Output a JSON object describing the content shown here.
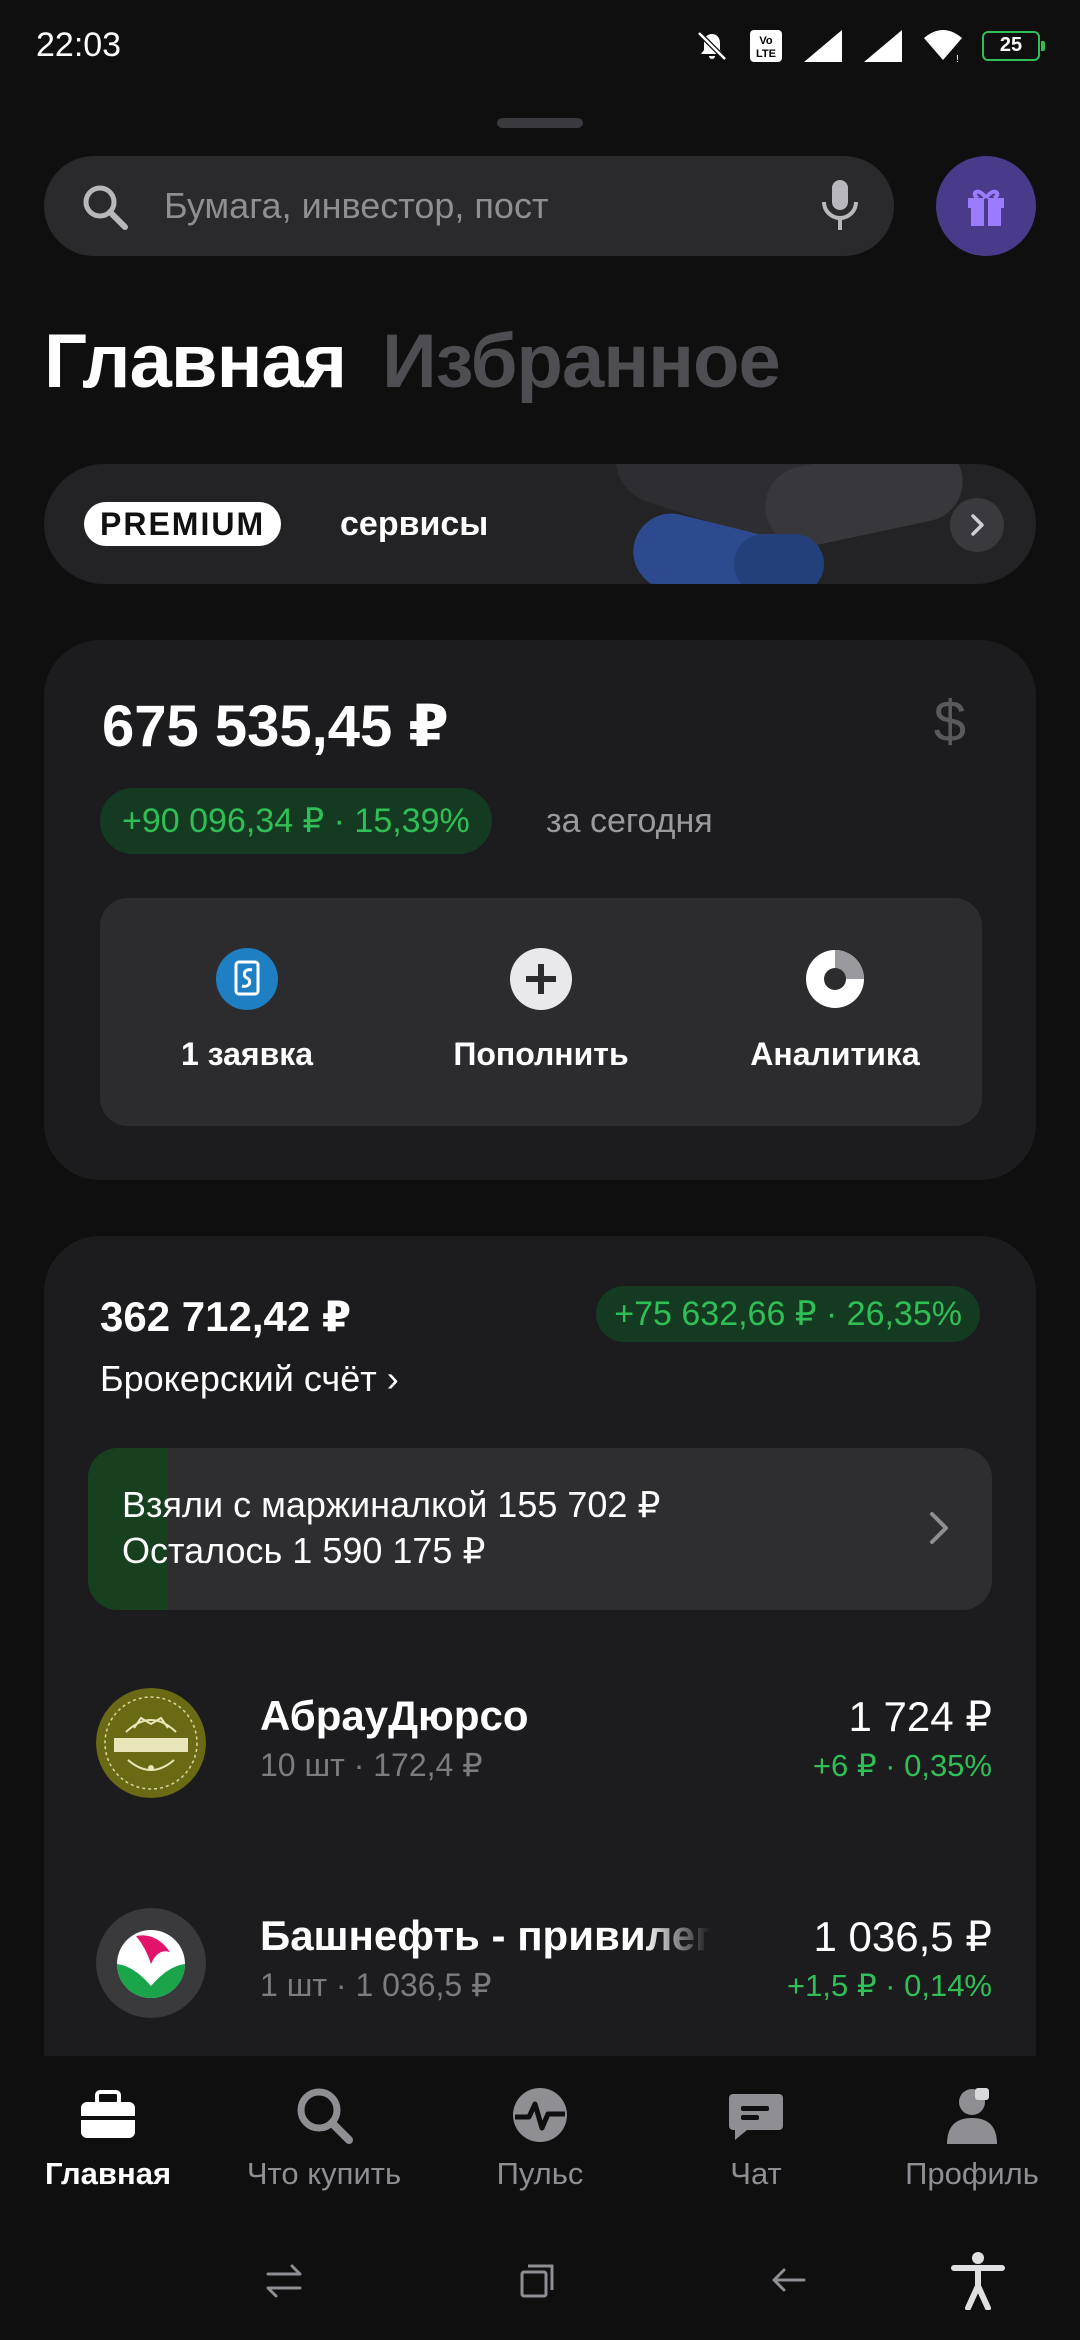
{
  "status_bar": {
    "time": "22:03",
    "battery": "25",
    "icons": [
      "mute-icon",
      "volte-icon",
      "signal-icon",
      "signal-icon",
      "wifi-icon",
      "battery-icon"
    ]
  },
  "search": {
    "placeholder": "Бумага, инвестор, пост"
  },
  "tabs": [
    {
      "label": "Главная",
      "active": true
    },
    {
      "label": "Избранное",
      "active": false
    }
  ],
  "premium": {
    "badge": "PREMIUM",
    "label": "сервисы"
  },
  "portfolio": {
    "total": "675 535,45 ₽",
    "currency_icon": "$",
    "gain": "+90 096,34 ₽ · 15,39%",
    "gain_period": "за сегодня",
    "actions": [
      {
        "label": "1 заявка",
        "icon": "order-icon"
      },
      {
        "label": "Пополнить",
        "icon": "plus-icon"
      },
      {
        "label": "Аналитика",
        "icon": "analytics-icon"
      }
    ]
  },
  "broker": {
    "amount": "362 712,42 ₽",
    "gain": "+75 632,66 ₽ · 26,35%",
    "account_link": "Брокерский счёт ›",
    "margin": {
      "line1": "Взяли с маржиналкой 155 702 ₽",
      "line2": "Осталось 1 590 175 ₽",
      "used_fraction": 0.089
    }
  },
  "stocks": [
    {
      "name": "АбрауДюрсо",
      "qty": "10 шт · 172,4 ₽",
      "price": "1 724 ₽",
      "change": "+6 ₽ · 0,35%",
      "logo_text": "АБРАУ-ДЮРСО"
    },
    {
      "name": "Башнефть - привилег",
      "qty": "1 шт · 1 036,5 ₽",
      "price": "1 036,5 ₽",
      "change": "+1,5 ₽ · 0,14%"
    }
  ],
  "bottom_nav": [
    {
      "label": "Главная",
      "icon": "briefcase-icon",
      "active": true
    },
    {
      "label": "Что купить",
      "icon": "search-icon",
      "active": false
    },
    {
      "label": "Пульс",
      "icon": "pulse-icon",
      "active": false
    },
    {
      "label": "Чат",
      "icon": "chat-icon",
      "active": false
    },
    {
      "label": "Профиль",
      "icon": "profile-icon",
      "active": false
    }
  ],
  "colors": {
    "positive": "#2fbf55",
    "positive_bg": "#143a22",
    "card": "#1c1c1f",
    "background": "#0f0f10",
    "accent_purple": "#4a3a8a"
  }
}
